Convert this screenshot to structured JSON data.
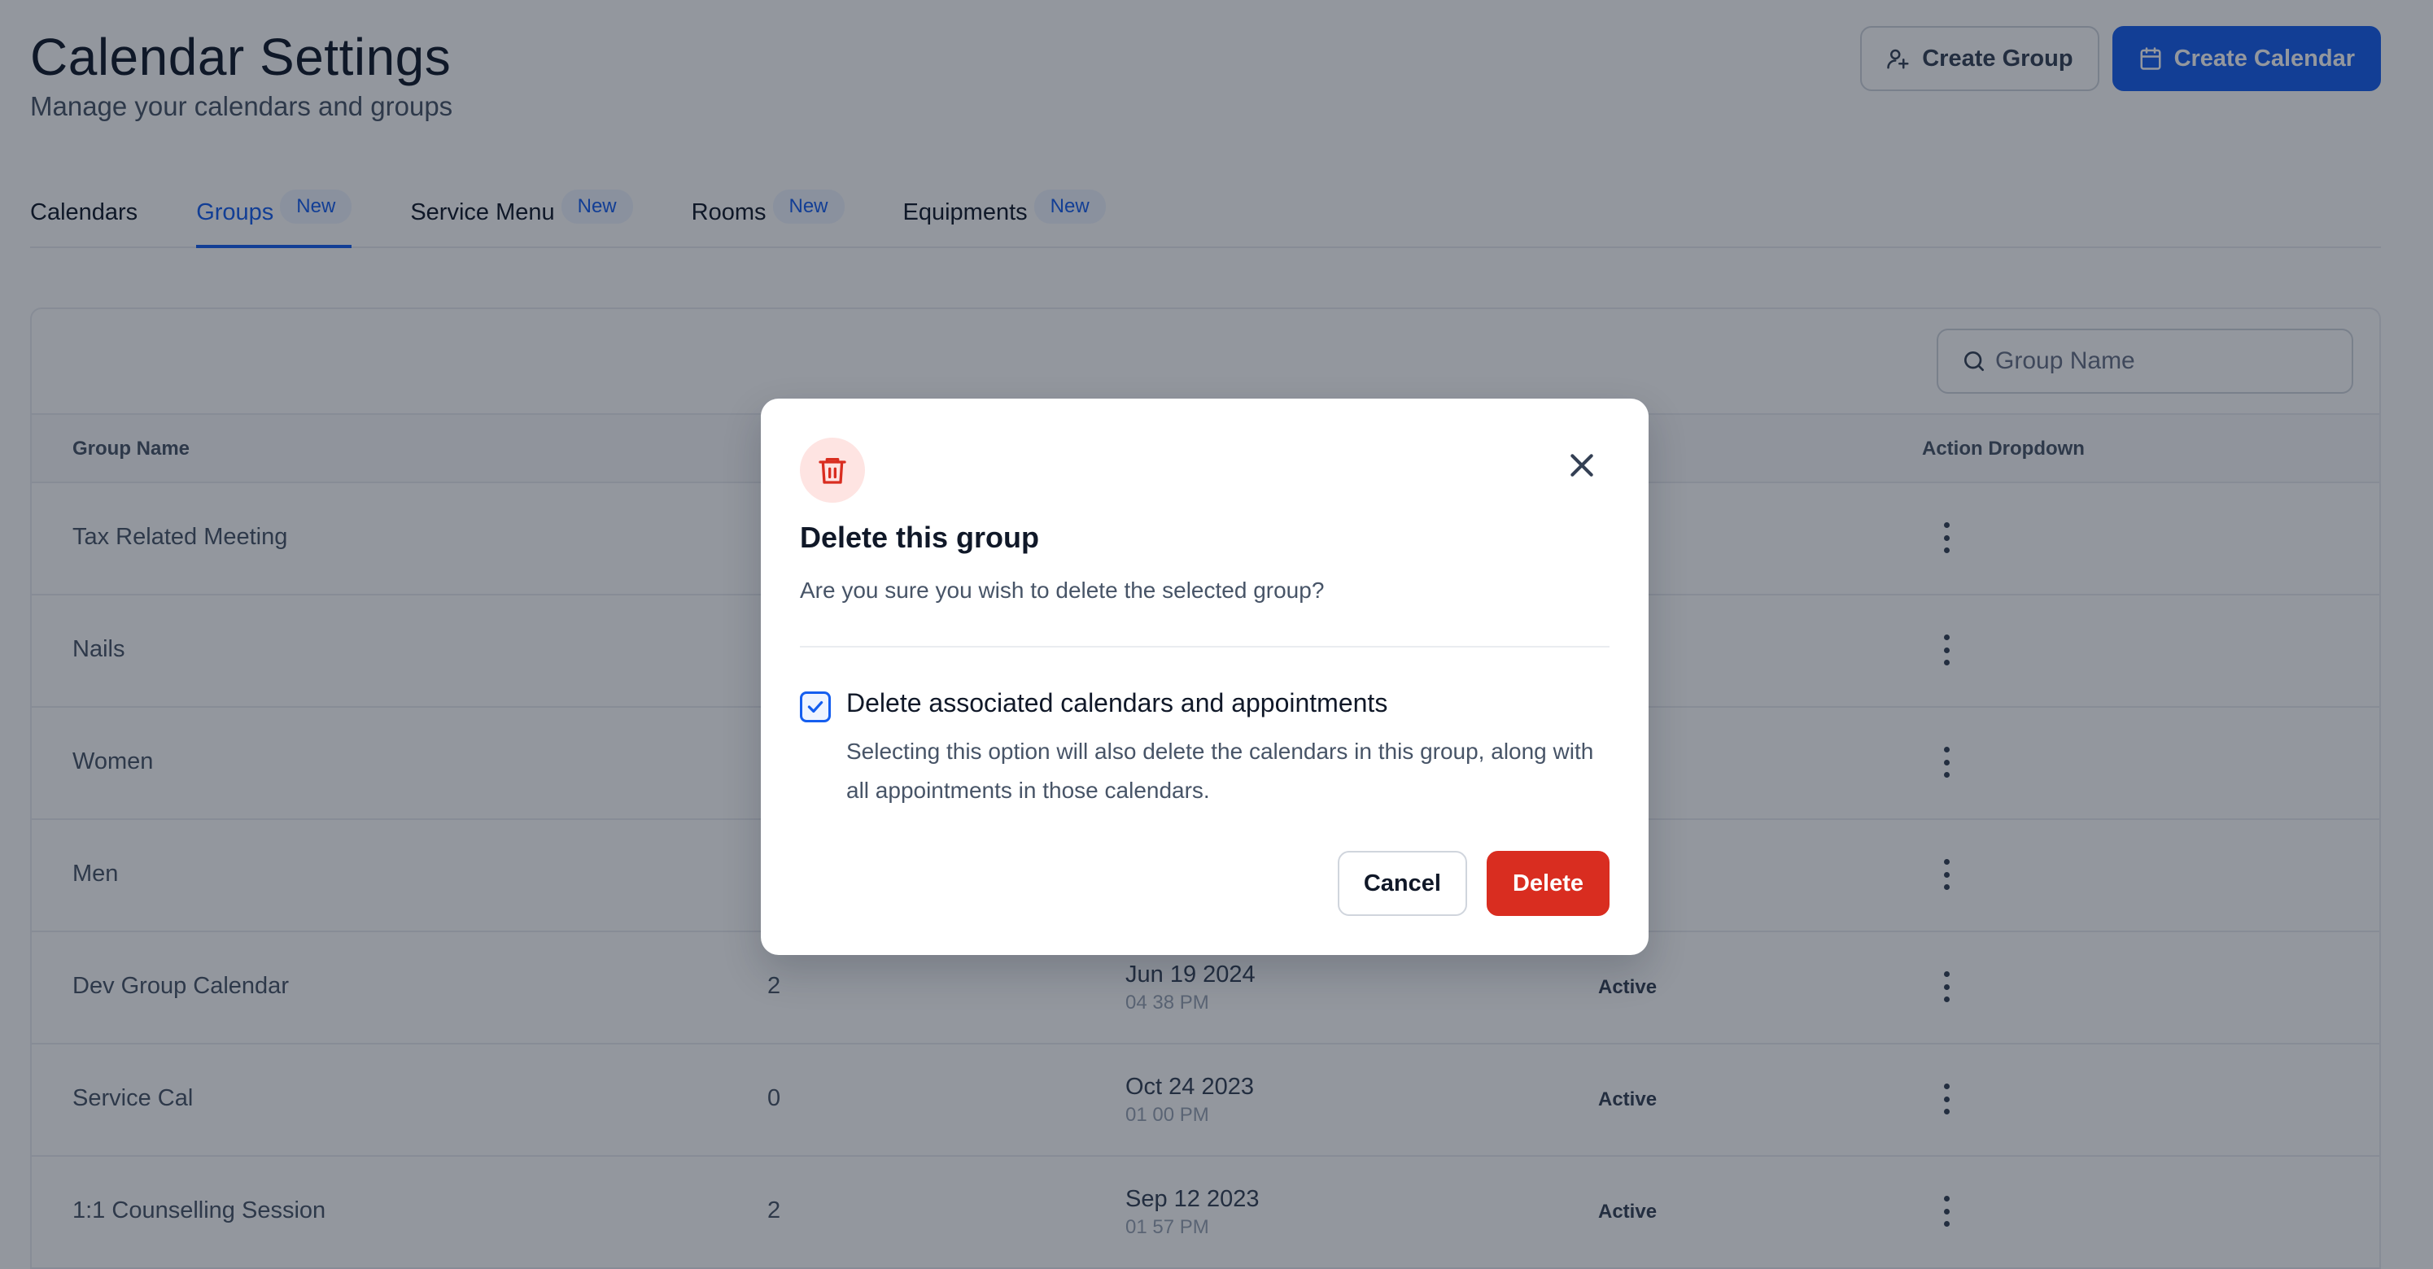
{
  "header": {
    "title": "Calendar Settings",
    "subtitle": "Manage your calendars and groups",
    "create_group_label": "Create Group",
    "create_calendar_label": "Create Calendar"
  },
  "tabs": [
    {
      "label": "Calendars",
      "badge": "",
      "active": false
    },
    {
      "label": "Groups",
      "badge": "New",
      "active": true
    },
    {
      "label": "Service Menu",
      "badge": "New",
      "active": false
    },
    {
      "label": "Rooms",
      "badge": "New",
      "active": false
    },
    {
      "label": "Equipments",
      "badge": "New",
      "active": false
    }
  ],
  "search": {
    "placeholder": "Group Name",
    "value": ""
  },
  "table": {
    "columns": [
      "Group Name",
      "Action Dropdown"
    ],
    "rows": [
      {
        "name": "Tax Related Meeting",
        "count": "",
        "date": "",
        "time": "",
        "status": "e"
      },
      {
        "name": "Nails",
        "count": "",
        "date": "",
        "time": "",
        "status": "e"
      },
      {
        "name": "Women",
        "count": "",
        "date": "",
        "time": "",
        "status": "e"
      },
      {
        "name": "Men",
        "count": "",
        "date": "",
        "time": "",
        "status": "e"
      },
      {
        "name": "Dev Group Calendar",
        "count": "2",
        "date": "Jun 19 2024",
        "time": "04 38 PM",
        "status": "Active"
      },
      {
        "name": "Service Cal",
        "count": "0",
        "date": "Oct 24 2023",
        "time": "01 00 PM",
        "status": "Active"
      },
      {
        "name": "1:1 Counselling Session",
        "count": "2",
        "date": "Sep 12 2023",
        "time": "01 57 PM",
        "status": "Active"
      }
    ]
  },
  "modal": {
    "icon": "trash-icon",
    "title": "Delete this group",
    "description": "Are you sure you wish to delete the selected group?",
    "checkbox_checked": true,
    "checkbox_label": "Delete associated calendars and appointments",
    "checkbox_help": "Selecting this option will also delete the calendars in this group, along with all appointments in those calendars.",
    "cancel_label": "Cancel",
    "delete_label": "Delete"
  },
  "colors": {
    "primary": "#155eef",
    "danger": "#d92d20",
    "badge_bg": "#eff4ff",
    "overlay": "rgba(16,24,40,0.45)"
  }
}
